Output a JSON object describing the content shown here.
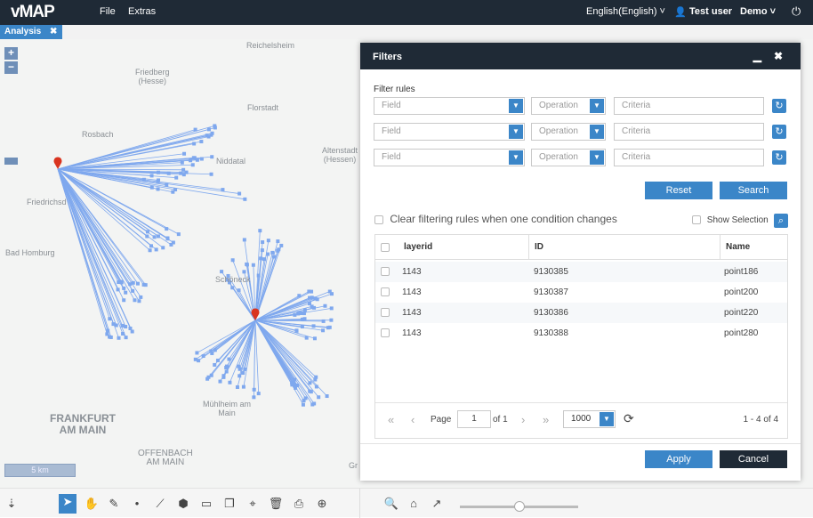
{
  "header": {
    "logo": "vMAP",
    "menu": [
      "File",
      "Extras"
    ],
    "language": "English(English) ˅",
    "user": "Test user",
    "org": "Demo ˅"
  },
  "tabs": [
    {
      "label": "Analysis",
      "close": "✖"
    }
  ],
  "map": {
    "labels": [
      "Reichelsheim",
      "Friedberg\n(Hesse)",
      "Florstadt",
      "Rosbach",
      "Altenstadt\n(Hessen)",
      "Niddatal",
      "Friedrichsd",
      "Bad Homburg",
      "Schöneck",
      "Mühlheim am\nMain",
      "FRANKFURT\nAM MAIN",
      "OFFENBACH\nAM MAIN",
      "Gr"
    ],
    "scale": "5 km",
    "line_color": "#7fa8ee",
    "marker_color": "#d9341f"
  },
  "dialog": {
    "title": "Filters",
    "filter_rules_label": "Filter rules",
    "rules": [
      {
        "field": "Field",
        "operation": "Operation",
        "criteria": "Criteria"
      },
      {
        "field": "Field",
        "operation": "Operation",
        "criteria": "Criteria"
      },
      {
        "field": "Field",
        "operation": "Operation",
        "criteria": "Criteria"
      }
    ],
    "reset": "Reset",
    "search": "Search",
    "clear_rules_label": "Clear filtering rules when one condition changes",
    "show_selection": "Show Selection",
    "columns": [
      "layerid",
      "ID",
      "Name"
    ],
    "rows": [
      [
        "1143",
        "9130385",
        "point186"
      ],
      [
        "1143",
        "9130387",
        "point200"
      ],
      [
        "1143",
        "9130386",
        "point220"
      ],
      [
        "1143",
        "9130388",
        "point280"
      ]
    ],
    "pager": {
      "page_label": "Page",
      "page": "1",
      "of": "of 1",
      "page_size": "1000",
      "summary": "1 - 4 of 4"
    },
    "apply": "Apply",
    "cancel": "Cancel"
  },
  "accent": "#3b86c8",
  "header_bg": "#1f2a36"
}
